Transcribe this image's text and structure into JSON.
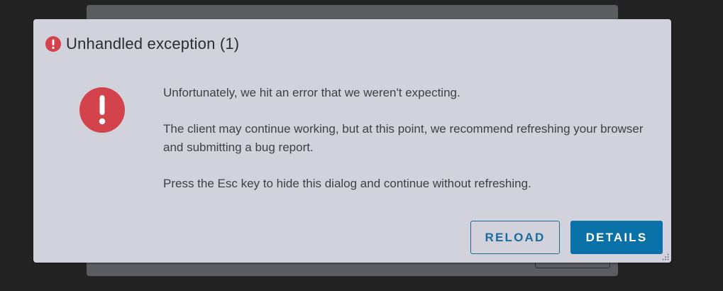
{
  "dialog": {
    "title": "Unhandled exception (1)",
    "messages": [
      "Unfortunately, we hit an error that we weren't expecting.",
      "The client may continue working, but at this point, we recommend refreshing your browser and submitting a bug report.",
      "Press the Esc key to hide this dialog and continue without refreshing."
    ],
    "reload_label": "RELOAD",
    "details_label": "DETAILS"
  },
  "colors": {
    "error_red": "#d2434b",
    "primary_blue": "#0a70a8",
    "dialog_bg": "#d1d2dc",
    "page_bg": "#232323"
  },
  "icons": {
    "title_icon": "error-circle-icon",
    "main_icon": "error-circle-icon",
    "grip_icon": "resize-grip-icon"
  }
}
